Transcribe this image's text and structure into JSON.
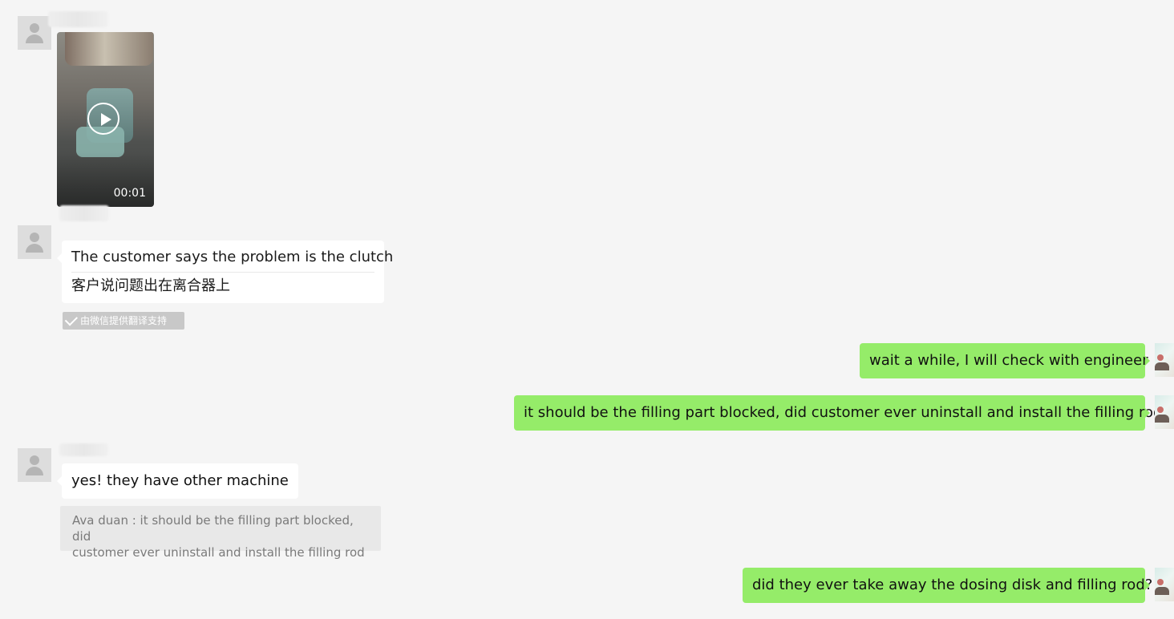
{
  "chat": {
    "messages": [
      {
        "side": "left",
        "type": "video",
        "duration": "00:01"
      },
      {
        "side": "left",
        "type": "translated_text",
        "original": "The customer says the problem is the clutch",
        "translation": "客户说问题出在离合器上",
        "translation_note": "由微信提供翻译支持"
      },
      {
        "side": "right",
        "type": "text",
        "text": "wait a while, I will check with engineer"
      },
      {
        "side": "right",
        "type": "text",
        "text": "it should be the filling part blocked, did customer ever uninstall and install the filling rod"
      },
      {
        "side": "left",
        "type": "text",
        "text": "yes! they have other machine",
        "quote": {
          "line1": "Ava duan : it should be the filling part blocked, did",
          "line2": "customer ever uninstall and install the filling rod"
        }
      },
      {
        "side": "right",
        "type": "text",
        "text": "did they ever take away the dosing disk and filling rod?"
      }
    ]
  }
}
